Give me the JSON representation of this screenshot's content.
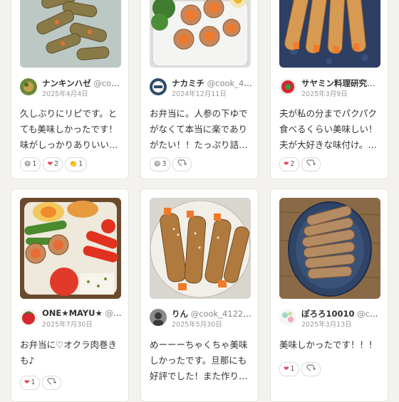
{
  "colors": {
    "accent": "#e04b5a",
    "page_bg": "#f3f2ee"
  },
  "cards": [
    {
      "author": "ナンキンハゼ",
      "handle": "@cook…",
      "date": "2025年4月4日",
      "comment": "久しぶりにリピです。とても美味しかったです！味がしっかりありいい…",
      "reactions": [
        {
          "icon": "laugh-emoji",
          "emoji": "😄",
          "count": "1"
        },
        {
          "icon": "heart-emoji",
          "emoji": "❤",
          "count": "2"
        },
        {
          "icon": "clap-emoji",
          "emoji": "👏",
          "count": "1"
        }
      ],
      "add_reaction": true
    },
    {
      "author": "ナカミチ",
      "handle": "@cook_40…",
      "date": "2024年12月11日",
      "comment": "お弁当に。人参の下ゆでがなくて本当に楽でありがたい！！たっぷり詰…",
      "reactions": [
        {
          "icon": "laugh-emoji",
          "emoji": "😄",
          "count": "3"
        }
      ],
      "add_reaction": true
    },
    {
      "author": "サヤミン料理研究所…",
      "handle": "",
      "date": "2025年3月9日",
      "comment": "夫が私の分までパクパク食べるくらい美味しい！夫が大好きな味付け。…",
      "reactions": [
        {
          "icon": "heart-emoji",
          "emoji": "❤",
          "count": "2"
        }
      ],
      "add_reaction": true
    },
    {
      "author": "ONE★MAYU★",
      "handle": "@co…",
      "date": "2025年7月30日",
      "comment": "お弁当に♡オクラ肉巻きも♪",
      "reactions": [
        {
          "icon": "heart-emoji",
          "emoji": "❤",
          "count": "1"
        }
      ],
      "add_reaction": true
    },
    {
      "author": "りん",
      "handle": "@cook_412293…",
      "date": "2025年5月30日",
      "comment": "めーーーちゃくちゃ美味しかったです。旦那にも好評でした！また作り…",
      "reactions": [],
      "add_reaction": false
    },
    {
      "author": "ぽろろ10010",
      "handle": "@cook…",
      "date": "2025年3月13日",
      "comment": "美味しかったです！！！",
      "reactions": [
        {
          "icon": "heart-emoji",
          "emoji": "❤",
          "count": "1"
        }
      ],
      "add_reaction": true
    }
  ]
}
